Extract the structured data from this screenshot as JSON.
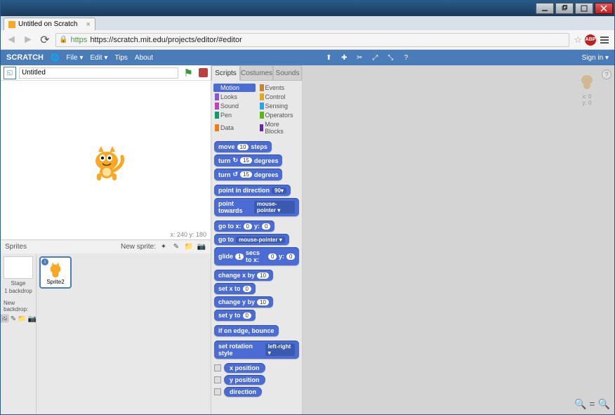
{
  "browser": {
    "tab_title": "Untitled on Scratch",
    "url": "https://scratch.mit.edu/projects/editor/#editor",
    "url_scheme": "https",
    "abp_label": "ABP"
  },
  "menubar": {
    "logo": "SCRATCH",
    "items": [
      "File ▾",
      "Edit ▾",
      "Tips",
      "About"
    ],
    "signin": "Sign in ▾"
  },
  "project": {
    "title_placeholder": "Untitled",
    "coords": "x: 240  y: 180"
  },
  "sprite_panel": {
    "header": "Sprites",
    "new_sprite": "New sprite:",
    "stage_label": "Stage",
    "backdrop_label": "1 backdrop",
    "new_backdrop": "New backdrop:",
    "selected_sprite": "Sprite2"
  },
  "editor_tabs": [
    "Scripts",
    "Costumes",
    "Sounds"
  ],
  "categories": [
    {
      "name": "Motion",
      "color": "#4a6cd4",
      "active": true
    },
    {
      "name": "Events",
      "color": "#c88330"
    },
    {
      "name": "Looks",
      "color": "#8a55d7"
    },
    {
      "name": "Control",
      "color": "#e1a91a"
    },
    {
      "name": "Sound",
      "color": "#bb42c3"
    },
    {
      "name": "Sensing",
      "color": "#2ca5e2"
    },
    {
      "name": "Pen",
      "color": "#0e9a6c"
    },
    {
      "name": "Operators",
      "color": "#5cb712"
    },
    {
      "name": "Data",
      "color": "#ee7d16"
    },
    {
      "name": "More Blocks",
      "color": "#632d99"
    }
  ],
  "blocks": {
    "move_label": "move",
    "move_val": "10",
    "move_suffix": "steps",
    "turn_cw_label": "turn",
    "turn_cw_icon": "↻",
    "turn_cw_val": "15",
    "turn_cw_suffix": "degrees",
    "turn_ccw_label": "turn",
    "turn_ccw_icon": "↺",
    "turn_ccw_val": "15",
    "turn_ccw_suffix": "degrees",
    "point_dir_label": "point in direction",
    "point_dir_val": "90▾",
    "point_towards_label": "point towards",
    "point_towards_val": "mouse-pointer ▾",
    "goto_xy_label": "go to x:",
    "goto_x": "0",
    "goto_y_label": "y:",
    "goto_y": "0",
    "goto_label": "go to",
    "goto_val": "mouse-pointer ▾",
    "glide_label": "glide",
    "glide_secs": "1",
    "glide_mid": "secs to x:",
    "glide_x": "0",
    "glide_y_label": "y:",
    "glide_y": "0",
    "changex_label": "change x by",
    "changex_val": "10",
    "setx_label": "set x to",
    "setx_val": "0",
    "changey_label": "change y by",
    "changey_val": "10",
    "sety_label": "set y to",
    "sety_val": "0",
    "bounce_label": "if on edge, bounce",
    "rotstyle_label": "set rotation style",
    "rotstyle_val": "left-right ▾",
    "xpos": "x position",
    "ypos": "y position",
    "dir": "direction"
  },
  "sprite_coords": {
    "x": "x: 0",
    "y": "y: 0"
  }
}
